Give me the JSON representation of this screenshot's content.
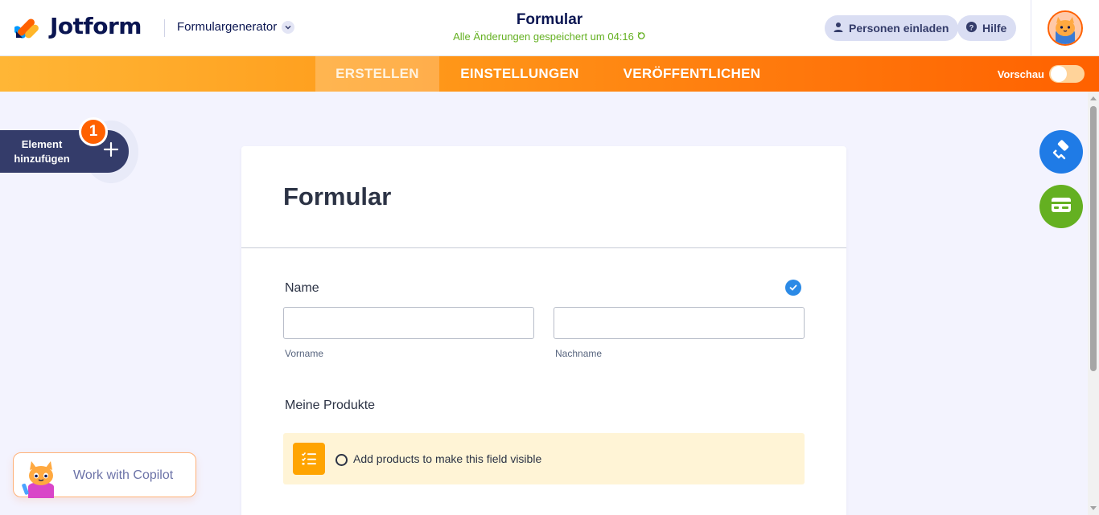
{
  "header": {
    "brand": "Jotform",
    "builder_menu": "Formulargenerator",
    "form_name": "Formular",
    "save_status": "Alle Änderungen gespeichert um 04:16",
    "invite_label": "Personen einladen",
    "help_label": "Hilfe"
  },
  "nav": {
    "tabs": [
      {
        "label": "ERSTELLEN",
        "active": true
      },
      {
        "label": "EINSTELLUNGEN",
        "active": false
      },
      {
        "label": "VERÖFFENTLICHEN",
        "active": false
      }
    ],
    "preview_label": "Vorschau",
    "preview_on": false
  },
  "sidebar": {
    "add_element_line1": "Element",
    "add_element_line2": "hinzufügen",
    "badge_count": "1"
  },
  "form": {
    "title": "Formular",
    "name_field": {
      "label": "Name",
      "first_value": "",
      "last_value": "",
      "first_sublabel": "Vorname",
      "last_sublabel": "Nachname"
    },
    "products_field": {
      "label": "Meine Produkte",
      "notice": "Add products to make this field visible"
    }
  },
  "copilot": {
    "label": "Work with Copilot"
  },
  "colors": {
    "brand_orange": "#ff6100",
    "navy": "#0a1551",
    "success_green": "#64b021",
    "design_blue": "#1f7be6",
    "notice_bg": "#fff4d6",
    "product_icon_bg": "#ffa400"
  },
  "icons": {
    "logo": "jotform-logo-icon",
    "chevron": "chevron-down-icon",
    "refresh": "refresh-icon",
    "invite": "user-icon",
    "help": "question-icon",
    "add": "plus-icon",
    "design": "paint-roller-icon",
    "payment": "credit-card-icon",
    "required_check": "check-circle-icon",
    "product_list": "list-check-icon"
  }
}
